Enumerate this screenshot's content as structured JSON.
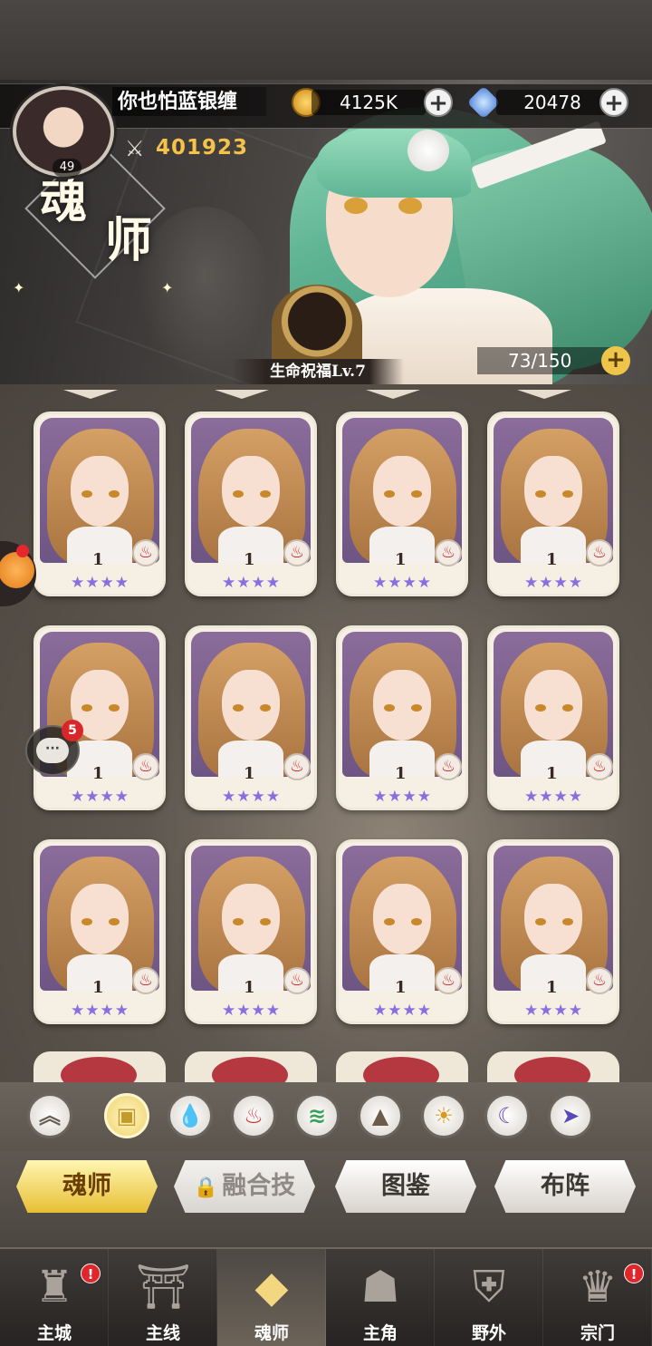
{
  "player": {
    "name": "你也怕蓝银缠",
    "level": "49",
    "power": "401923"
  },
  "currency": {
    "gold": "4125K",
    "gems": "20478",
    "plus": "+"
  },
  "banner": {
    "title_char_1": "魂",
    "title_char_2": "师",
    "blessing": "生命祝福Lv.7",
    "capacity": "73/150"
  },
  "cards": {
    "level": "1",
    "element_icon": "fire-icon",
    "stars": "★★★★",
    "count": 12
  },
  "chat": {
    "badge": "5",
    "bubble": "···"
  },
  "filters": {
    "icons": [
      "chevron-up-icon",
      "box-icon",
      "water-icon",
      "fire-icon",
      "wind-icon",
      "mountain-icon",
      "sun-icon",
      "moon-icon",
      "arrow-icon"
    ],
    "active_index": 1
  },
  "tabs": {
    "soul_master": "魂师",
    "fusion_skill": "融合技",
    "codex": "图鉴",
    "formation": "布阵",
    "active": "soul_master"
  },
  "nav": {
    "main_city": "主城",
    "main_line": "主线",
    "soul_master": "魂师",
    "protagonist": "主角",
    "wild": "野外",
    "sect": "宗门",
    "badge": "!"
  },
  "colors": {
    "accent_gold": "#efc44a",
    "power_gold": "#f6c24a",
    "star_purple": "#8a6de0",
    "fire_red": "#c6262e",
    "badge_red": "#e0262a"
  }
}
